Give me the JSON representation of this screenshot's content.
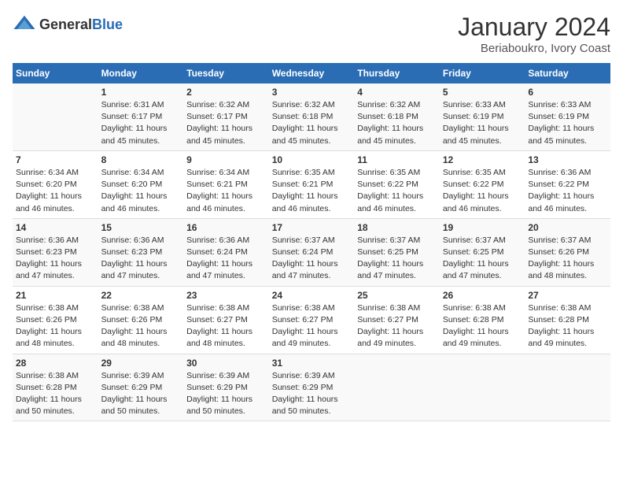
{
  "logo": {
    "general": "General",
    "blue": "Blue"
  },
  "header": {
    "title": "January 2024",
    "subtitle": "Beriaboukro, Ivory Coast"
  },
  "weekdays": [
    "Sunday",
    "Monday",
    "Tuesday",
    "Wednesday",
    "Thursday",
    "Friday",
    "Saturday"
  ],
  "weeks": [
    [
      {
        "day": "",
        "sunrise": "",
        "sunset": "",
        "daylight": ""
      },
      {
        "day": "1",
        "sunrise": "Sunrise: 6:31 AM",
        "sunset": "Sunset: 6:17 PM",
        "daylight": "Daylight: 11 hours and 45 minutes."
      },
      {
        "day": "2",
        "sunrise": "Sunrise: 6:32 AM",
        "sunset": "Sunset: 6:17 PM",
        "daylight": "Daylight: 11 hours and 45 minutes."
      },
      {
        "day": "3",
        "sunrise": "Sunrise: 6:32 AM",
        "sunset": "Sunset: 6:18 PM",
        "daylight": "Daylight: 11 hours and 45 minutes."
      },
      {
        "day": "4",
        "sunrise": "Sunrise: 6:32 AM",
        "sunset": "Sunset: 6:18 PM",
        "daylight": "Daylight: 11 hours and 45 minutes."
      },
      {
        "day": "5",
        "sunrise": "Sunrise: 6:33 AM",
        "sunset": "Sunset: 6:19 PM",
        "daylight": "Daylight: 11 hours and 45 minutes."
      },
      {
        "day": "6",
        "sunrise": "Sunrise: 6:33 AM",
        "sunset": "Sunset: 6:19 PM",
        "daylight": "Daylight: 11 hours and 45 minutes."
      }
    ],
    [
      {
        "day": "7",
        "sunrise": "Sunrise: 6:34 AM",
        "sunset": "Sunset: 6:20 PM",
        "daylight": "Daylight: 11 hours and 46 minutes."
      },
      {
        "day": "8",
        "sunrise": "Sunrise: 6:34 AM",
        "sunset": "Sunset: 6:20 PM",
        "daylight": "Daylight: 11 hours and 46 minutes."
      },
      {
        "day": "9",
        "sunrise": "Sunrise: 6:34 AM",
        "sunset": "Sunset: 6:21 PM",
        "daylight": "Daylight: 11 hours and 46 minutes."
      },
      {
        "day": "10",
        "sunrise": "Sunrise: 6:35 AM",
        "sunset": "Sunset: 6:21 PM",
        "daylight": "Daylight: 11 hours and 46 minutes."
      },
      {
        "day": "11",
        "sunrise": "Sunrise: 6:35 AM",
        "sunset": "Sunset: 6:22 PM",
        "daylight": "Daylight: 11 hours and 46 minutes."
      },
      {
        "day": "12",
        "sunrise": "Sunrise: 6:35 AM",
        "sunset": "Sunset: 6:22 PM",
        "daylight": "Daylight: 11 hours and 46 minutes."
      },
      {
        "day": "13",
        "sunrise": "Sunrise: 6:36 AM",
        "sunset": "Sunset: 6:22 PM",
        "daylight": "Daylight: 11 hours and 46 minutes."
      }
    ],
    [
      {
        "day": "14",
        "sunrise": "Sunrise: 6:36 AM",
        "sunset": "Sunset: 6:23 PM",
        "daylight": "Daylight: 11 hours and 47 minutes."
      },
      {
        "day": "15",
        "sunrise": "Sunrise: 6:36 AM",
        "sunset": "Sunset: 6:23 PM",
        "daylight": "Daylight: 11 hours and 47 minutes."
      },
      {
        "day": "16",
        "sunrise": "Sunrise: 6:36 AM",
        "sunset": "Sunset: 6:24 PM",
        "daylight": "Daylight: 11 hours and 47 minutes."
      },
      {
        "day": "17",
        "sunrise": "Sunrise: 6:37 AM",
        "sunset": "Sunset: 6:24 PM",
        "daylight": "Daylight: 11 hours and 47 minutes."
      },
      {
        "day": "18",
        "sunrise": "Sunrise: 6:37 AM",
        "sunset": "Sunset: 6:25 PM",
        "daylight": "Daylight: 11 hours and 47 minutes."
      },
      {
        "day": "19",
        "sunrise": "Sunrise: 6:37 AM",
        "sunset": "Sunset: 6:25 PM",
        "daylight": "Daylight: 11 hours and 47 minutes."
      },
      {
        "day": "20",
        "sunrise": "Sunrise: 6:37 AM",
        "sunset": "Sunset: 6:26 PM",
        "daylight": "Daylight: 11 hours and 48 minutes."
      }
    ],
    [
      {
        "day": "21",
        "sunrise": "Sunrise: 6:38 AM",
        "sunset": "Sunset: 6:26 PM",
        "daylight": "Daylight: 11 hours and 48 minutes."
      },
      {
        "day": "22",
        "sunrise": "Sunrise: 6:38 AM",
        "sunset": "Sunset: 6:26 PM",
        "daylight": "Daylight: 11 hours and 48 minutes."
      },
      {
        "day": "23",
        "sunrise": "Sunrise: 6:38 AM",
        "sunset": "Sunset: 6:27 PM",
        "daylight": "Daylight: 11 hours and 48 minutes."
      },
      {
        "day": "24",
        "sunrise": "Sunrise: 6:38 AM",
        "sunset": "Sunset: 6:27 PM",
        "daylight": "Daylight: 11 hours and 49 minutes."
      },
      {
        "day": "25",
        "sunrise": "Sunrise: 6:38 AM",
        "sunset": "Sunset: 6:27 PM",
        "daylight": "Daylight: 11 hours and 49 minutes."
      },
      {
        "day": "26",
        "sunrise": "Sunrise: 6:38 AM",
        "sunset": "Sunset: 6:28 PM",
        "daylight": "Daylight: 11 hours and 49 minutes."
      },
      {
        "day": "27",
        "sunrise": "Sunrise: 6:38 AM",
        "sunset": "Sunset: 6:28 PM",
        "daylight": "Daylight: 11 hours and 49 minutes."
      }
    ],
    [
      {
        "day": "28",
        "sunrise": "Sunrise: 6:38 AM",
        "sunset": "Sunset: 6:28 PM",
        "daylight": "Daylight: 11 hours and 50 minutes."
      },
      {
        "day": "29",
        "sunrise": "Sunrise: 6:39 AM",
        "sunset": "Sunset: 6:29 PM",
        "daylight": "Daylight: 11 hours and 50 minutes."
      },
      {
        "day": "30",
        "sunrise": "Sunrise: 6:39 AM",
        "sunset": "Sunset: 6:29 PM",
        "daylight": "Daylight: 11 hours and 50 minutes."
      },
      {
        "day": "31",
        "sunrise": "Sunrise: 6:39 AM",
        "sunset": "Sunset: 6:29 PM",
        "daylight": "Daylight: 11 hours and 50 minutes."
      },
      {
        "day": "",
        "sunrise": "",
        "sunset": "",
        "daylight": ""
      },
      {
        "day": "",
        "sunrise": "",
        "sunset": "",
        "daylight": ""
      },
      {
        "day": "",
        "sunrise": "",
        "sunset": "",
        "daylight": ""
      }
    ]
  ]
}
